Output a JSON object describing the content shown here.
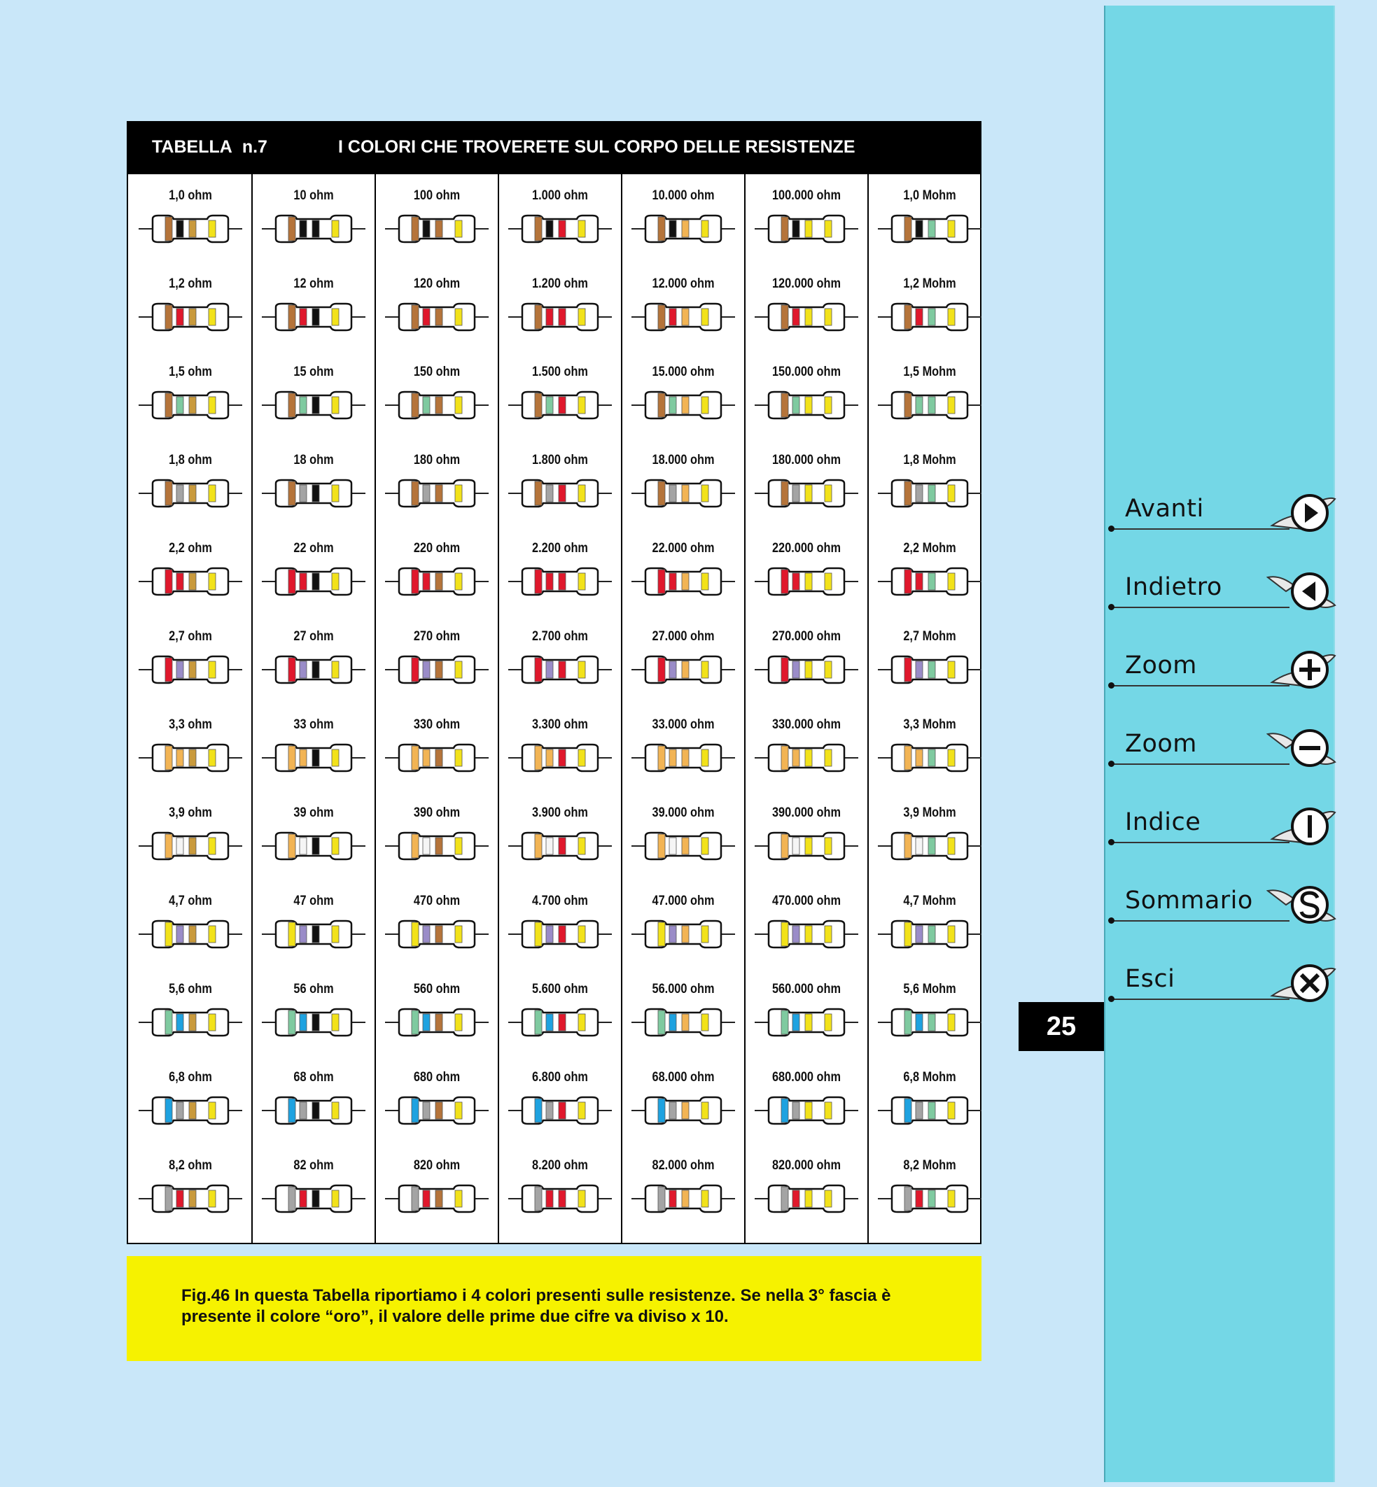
{
  "table": {
    "number": "TABELLA n.7",
    "title": "I COLORI CHE TROVERETE SUL CORPO DELLE RESISTENZE",
    "columns": [
      [
        "1,0 ohm",
        "1,2 ohm",
        "1,5 ohm",
        "1,8 ohm",
        "2,2 ohm",
        "2,7 ohm",
        "3,3 ohm",
        "3,9 ohm",
        "4,7 ohm",
        "5,6 ohm",
        "6,8 ohm",
        "8,2 ohm"
      ],
      [
        "10 ohm",
        "12 ohm",
        "15 ohm",
        "18 ohm",
        "22 ohm",
        "27 ohm",
        "33 ohm",
        "39 ohm",
        "47 ohm",
        "56 ohm",
        "68 ohm",
        "82 ohm"
      ],
      [
        "100 ohm",
        "120 ohm",
        "150 ohm",
        "180 ohm",
        "220 ohm",
        "270 ohm",
        "330 ohm",
        "390 ohm",
        "470 ohm",
        "560 ohm",
        "680 ohm",
        "820 ohm"
      ],
      [
        "1.000 ohm",
        "1.200 ohm",
        "1.500 ohm",
        "1.800 ohm",
        "2.200 ohm",
        "2.700 ohm",
        "3.300 ohm",
        "3.900 ohm",
        "4.700 ohm",
        "5.600 ohm",
        "6.800 ohm",
        "8.200 ohm"
      ],
      [
        "10.000 ohm",
        "12.000 ohm",
        "15.000 ohm",
        "18.000 ohm",
        "22.000 ohm",
        "27.000 ohm",
        "33.000 ohm",
        "39.000 ohm",
        "47.000 ohm",
        "56.000 ohm",
        "68.000 ohm",
        "82.000 ohm"
      ],
      [
        "100.000 ohm",
        "120.000 ohm",
        "150.000 ohm",
        "180.000 ohm",
        "220.000 ohm",
        "270.000 ohm",
        "330.000 ohm",
        "390.000 ohm",
        "470.000 ohm",
        "560.000 ohm",
        "680.000 ohm",
        "820.000 ohm"
      ],
      [
        "1,0 Mohm",
        "1,2 Mohm",
        "1,5 Mohm",
        "1,8 Mohm",
        "2,2 Mohm",
        "2,7 Mohm",
        "3,3 Mohm",
        "3,9 Mohm",
        "4,7 Mohm",
        "5,6 Mohm",
        "6,8 Mohm",
        "8,2 Mohm"
      ]
    ],
    "digit_colors": [
      "#111111",
      "#b5743a",
      "#e0182c",
      "#f2b454",
      "#f2e21a",
      "#7fcaa0",
      "#1ea2e0",
      "#9a8cc8",
      "#a4a4a4",
      "#f5f5f5"
    ],
    "gold_color": "#c99a3c",
    "tolerance_color": "#f2e21a"
  },
  "caption": "Fig.46 In questa Tabella riportiamo i 4 colori presenti sulle resistenze. Se nella 3° fascia è presente il colore “oro”, il valore delle prime due cifre va diviso x 10.",
  "page_number": "25",
  "nav": [
    {
      "label": "Avanti",
      "icon": "arrow-right-icon"
    },
    {
      "label": "Indietro",
      "icon": "arrow-left-icon"
    },
    {
      "label": "Zoom",
      "icon": "zoom-in-icon"
    },
    {
      "label": "Zoom",
      "icon": "zoom-out-icon"
    },
    {
      "label": "Indice",
      "icon": "index-icon"
    },
    {
      "label": "Sommario",
      "icon": "summary-icon"
    },
    {
      "label": "Esci",
      "icon": "exit-icon"
    }
  ]
}
